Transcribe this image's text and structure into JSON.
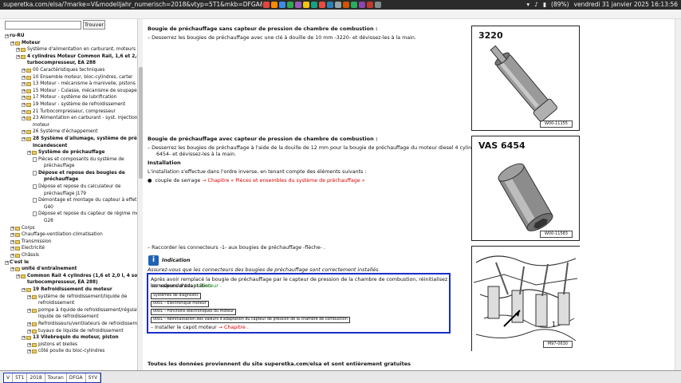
{
  "browser": {
    "url": "superetka.com/elsa/?marke=V&modelljahr_numerisch=2018&vtyp=5T1&mkb=DFGA&gkb=SYV&dir=rl&do",
    "battery": "(89%)",
    "datetime": "vendredi 31 janvier 2025 16:13:56"
  },
  "sidebar": {
    "search_placeholder": "",
    "find_button": "Trouver",
    "tree": [
      {
        "label": "ru-RU",
        "bold": true,
        "level": 0,
        "icon": "expander"
      },
      {
        "label": "Moteur",
        "bold": true,
        "level": 1,
        "icon": "folder"
      },
      {
        "label": "Système d'alimentation en carburant, moteurs diesel",
        "bold": false,
        "level": 2,
        "icon": "folder"
      },
      {
        "label": "4 cylindres Moteur Common Rail, 1,6 et 2,0 l, 4 kl.cyl,",
        "bold": true,
        "level": 2,
        "icon": "folder"
      },
      {
        "label": "turbocompresseur, EA 288",
        "bold": true,
        "level": 2,
        "icon": "none"
      },
      {
        "label": "00 Caractéristiques techniques",
        "bold": false,
        "level": 3,
        "icon": "folder"
      },
      {
        "label": "10 Ensemble moteur, bloc-cylindres, carter",
        "bold": false,
        "level": 3,
        "icon": "folder"
      },
      {
        "label": "13 Moteur - mécanisme à manivelle, pistons",
        "bold": false,
        "level": 3,
        "icon": "folder"
      },
      {
        "label": "15 Moteur - Culasse, mécanisme de soupape",
        "bold": false,
        "level": 3,
        "icon": "folder"
      },
      {
        "label": "17 Moteur - système de lubrification",
        "bold": false,
        "level": 3,
        "icon": "folder"
      },
      {
        "label": "19 Moteur - système de refroidissement",
        "bold": false,
        "level": 3,
        "icon": "folder"
      },
      {
        "label": "21 Turbocompresseur, compresseur",
        "bold": false,
        "level": 3,
        "icon": "folder"
      },
      {
        "label": "23 Alimentation en carburant - syst. injection diesel",
        "bold": false,
        "level": 3,
        "icon": "folder"
      },
      {
        "label": "moteur",
        "bold": false,
        "level": 3,
        "icon": "none"
      },
      {
        "label": "26 Système d'échappement",
        "bold": false,
        "level": 3,
        "icon": "folder"
      },
      {
        "label": "28 Système d'allumage, système de pré-allumage,",
        "bold": true,
        "level": 3,
        "icon": "folder"
      },
      {
        "label": "incandescent",
        "bold": true,
        "level": 3,
        "icon": "none"
      },
      {
        "label": "Système de préchauffage",
        "bold": true,
        "level": 4,
        "icon": "folder"
      },
      {
        "label": "Pièces et composants du système de",
        "bold": false,
        "level": 5,
        "icon": "doc"
      },
      {
        "label": "préchauffage",
        "bold": false,
        "level": 5,
        "icon": "none"
      },
      {
        "label": "Dépose et repose des bougies de",
        "bold": true,
        "level": 5,
        "icon": "doc"
      },
      {
        "label": "préchauffage",
        "bold": true,
        "level": 5,
        "icon": "none"
      },
      {
        "label": "Dépose et repose du calculateur de",
        "bold": false,
        "level": 5,
        "icon": "doc"
      },
      {
        "label": "préchauffage J179",
        "bold": false,
        "level": 5,
        "icon": "none"
      },
      {
        "label": "Démontage et montage du capteur à effet Hall",
        "bold": false,
        "level": 5,
        "icon": "doc"
      },
      {
        "label": "G40",
        "bold": false,
        "level": 5,
        "icon": "none"
      },
      {
        "label": "Dépose et repose du capteur de régime moteur",
        "bold": false,
        "level": 5,
        "icon": "doc"
      },
      {
        "label": "G28",
        "bold": false,
        "level": 5,
        "icon": "none"
      },
      {
        "label": "Corps",
        "bold": false,
        "level": 1,
        "icon": "folder"
      },
      {
        "label": "Chauffage-ventilation-climatisation",
        "bold": false,
        "level": 1,
        "icon": "folder"
      },
      {
        "label": "Transmission",
        "bold": false,
        "level": 1,
        "icon": "folder"
      },
      {
        "label": "Electricité",
        "bold": false,
        "level": 1,
        "icon": "folder"
      },
      {
        "label": "Châssis",
        "bold": false,
        "level": 1,
        "icon": "folder"
      },
      {
        "label": "C'est le",
        "bold": true,
        "level": 0,
        "icon": "expander"
      },
      {
        "label": "unité d'entraînement",
        "bold": true,
        "level": 1,
        "icon": "folder"
      },
      {
        "label": "Common Rail 4 cylindres (1,6 et 2,0 l, 4 soupapes,",
        "bold": true,
        "level": 2,
        "icon": "folder"
      },
      {
        "label": "turbocompresseur, EA 288)",
        "bold": true,
        "level": 2,
        "icon": "none"
      },
      {
        "label": "19 Refroidissement du moteur",
        "bold": true,
        "level": 3,
        "icon": "folder"
      },
      {
        "label": "système de refroidissement/liquide de",
        "bold": false,
        "level": 4,
        "icon": "folder"
      },
      {
        "label": "refroidissement",
        "bold": false,
        "level": 4,
        "icon": "none"
      },
      {
        "label": "pompe à liquide de refroidissement/régulateur de",
        "bold": false,
        "level": 4,
        "icon": "folder"
      },
      {
        "label": "liquide de refroidissement",
        "bold": false,
        "level": 4,
        "icon": "none"
      },
      {
        "label": "Refroidisseurs/ventilateurs de refroidissement",
        "bold": false,
        "level": 4,
        "icon": "folder"
      },
      {
        "label": "tuyaux de liquide de refroidissement",
        "bold": false,
        "level": 4,
        "icon": "folder"
      },
      {
        "label": "13 Vilebrequin du moteur, piston",
        "bold": true,
        "level": 3,
        "icon": "folder"
      },
      {
        "label": "pistons et bielles",
        "bold": false,
        "level": 4,
        "icon": "folder"
      },
      {
        "label": "côté poulie du bloc-cylindres",
        "bold": false,
        "level": 4,
        "icon": "folder"
      }
    ]
  },
  "content": {
    "h1": "Bougie de préchauffage sans capteur de pression de chambre de combustion :",
    "p1": "–   Desserrez les bougies de préchauffage avec une clé à douille de 10 mm -3220- et dévissez-les à la main.",
    "h2": "Bougie de préchauffage avec capteur de pression de chambre de combustion :",
    "p2a": "–   Desserrez les bougies de préchauffage à l'aide de la douille de 12 mm pour la bougie de préchauffage du moteur diesel 4 cylindres TDI CR -VAS",
    "p2b": "6454- et dévissez-les à la main.",
    "h3": "Installation",
    "p3": "L'installation s'effectue dans l'ordre inverse, en tenant compte des éléments suivants :",
    "bullet_prefix": "couple de serrage",
    "bullet_link": "→ Chapitre « Pièces et ensembles du système de préchauffage »",
    "p4": "–   Raccorder les connecteurs -1- aux bougies de préchauffage -flèche- .",
    "note_title": "Indication",
    "note_text": "Assurez-vous que les connecteurs des bougies de préchauffage sont correctement installés.",
    "box_line1": "Après avoir remplacé la bougie de préchauffage par le capteur de pression de la chambre de combustion, réinitialisez les valeurs d'adaptation",
    "box_line2_prefix": "correspondantes",
    "box_line2_link": "→ Testeur .",
    "box_steps": [
      "Systèmes de diagnostic",
      "0001 – Electronique moteur",
      "0001 – Fonctions électroniques du moteur",
      "0001 – Réinitialisation des valeurs d'adaptation du capteur de pression de la chambre de combustion"
    ],
    "box_last_prefix": "–   Installer le capot moteur",
    "box_last_link": "→ Chapitre .",
    "footer_note": "Toutes les données proviennent du site superetka.com/elsa et sont entièrement gratuites"
  },
  "figures": [
    {
      "label": "3220",
      "code": "W00-11155"
    },
    {
      "label": "VAS 6454",
      "code": "W00-11583"
    },
    {
      "label": "",
      "code": "M97-0630"
    }
  ],
  "footer_nav": [
    "V",
    "5T1",
    "2018",
    "Touran",
    "DFGA",
    "SYV"
  ],
  "colors": {
    "accent_box": "#1a2fc8",
    "link": "#dd0000",
    "note_icon": "#1f63b5"
  }
}
